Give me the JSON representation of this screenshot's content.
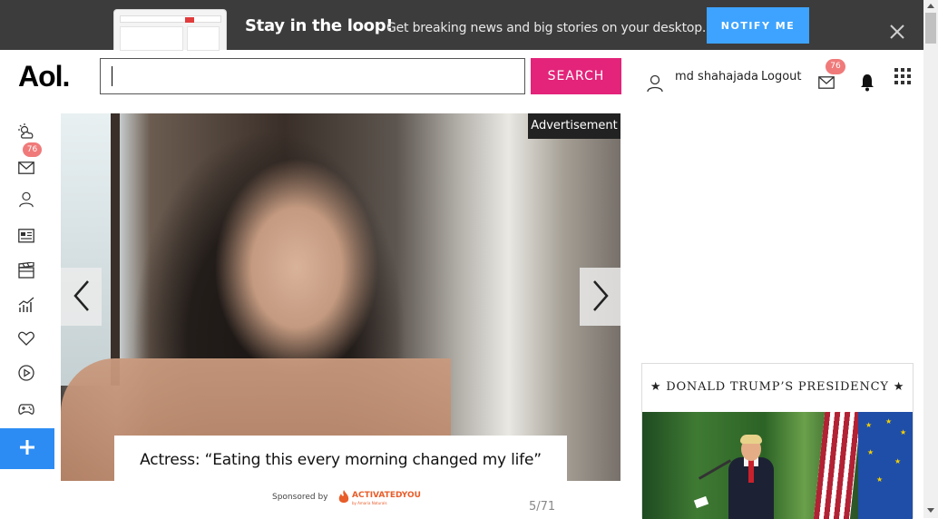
{
  "banner": {
    "title": "Stay in the loop!",
    "text": "Get breaking news and big stories on your desktop.",
    "notify_label": "NOTIFY ME"
  },
  "header": {
    "logo": "Aol.",
    "search_value": "",
    "search_label": "SEARCH",
    "username": "md shahajada",
    "logout_label": "Logout",
    "mail_count": "76"
  },
  "sidebar": {
    "mail_count": "76",
    "items": [
      "weather-icon",
      "mail-icon",
      "profile-icon",
      "news-icon",
      "entertainment-icon",
      "finance-icon",
      "lifestyle-icon",
      "video-icon",
      "games-icon",
      "plus-icon"
    ]
  },
  "slideshow": {
    "ad_label": "Advertisement",
    "caption": "Actress: “Eating this every morning changed my life”",
    "sponsored_label": "Sponsored by",
    "sponsor_name": "ACTIVATEDYOU",
    "sponsor_tagline": "by Amaria Naturals",
    "counter": "5/71"
  },
  "widget": {
    "title": "★ DONALD TRUMP’S PRESIDENCY ★"
  },
  "colors": {
    "banner_bg": "#3c3c3c",
    "notify_btn": "#3da3ff",
    "search_btn": "#e3247a",
    "badge": "#f07a7a",
    "plus_btn": "#2c8cf4"
  }
}
